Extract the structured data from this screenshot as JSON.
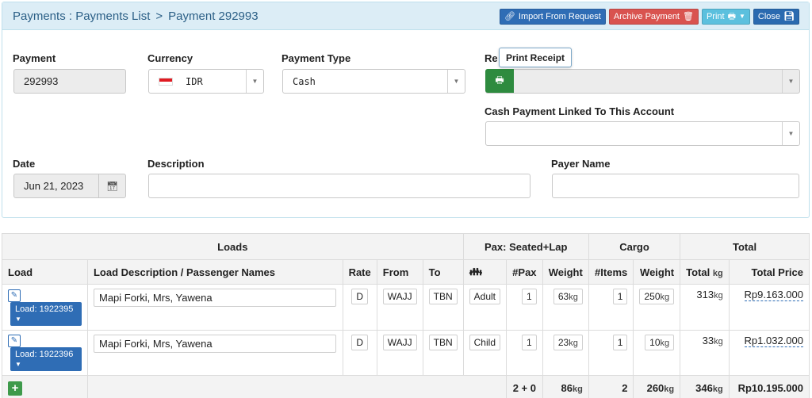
{
  "breadcrumb": {
    "section": "Payments : Payments List",
    "separator": ">",
    "current": "Payment 292993"
  },
  "header_buttons": {
    "import": "Import From Request",
    "archive": "Archive Payment",
    "print": "Print",
    "close": "Close"
  },
  "form": {
    "payment": {
      "label": "Payment",
      "value": "292993"
    },
    "currency": {
      "label": "Currency",
      "value": "IDR"
    },
    "payment_type": {
      "label": "Payment Type",
      "value": "Cash"
    },
    "receipt": {
      "label_visible": "Re",
      "tooltip": "Print Receipt"
    },
    "cash_account": {
      "label": "Cash Payment Linked To This Account",
      "value": ""
    },
    "date": {
      "label": "Date",
      "value": "Jun 21, 2023"
    },
    "description": {
      "label": "Description",
      "value": ""
    },
    "payer_name": {
      "label": "Payer Name",
      "value": ""
    }
  },
  "table": {
    "groups": {
      "loads": "Loads",
      "pax": "Pax: Seated+Lap",
      "cargo": "Cargo",
      "total": "Total"
    },
    "columns": {
      "load": "Load",
      "description": "Load Description / Passenger Names",
      "rate": "Rate",
      "from": "From",
      "to": "To",
      "pax_type_icon": "people-icon",
      "pax": "#Pax",
      "pax_weight": "Weight",
      "items": "#Items",
      "cargo_weight": "Weight",
      "total_kg": "Total",
      "total_kg_unit": "kg",
      "total_price": "Total Price"
    },
    "rows": [
      {
        "load": "Load: 1922395",
        "description": "Mapi Forki, Mrs, Yawena",
        "rate": "D",
        "from": "WAJJ",
        "to": "TBN",
        "pax_type": "Adult",
        "pax": "1",
        "pax_weight": "63",
        "items": "1",
        "cargo_weight": "250",
        "total_kg": "313",
        "total_price": "Rp9.163.000"
      },
      {
        "load": "Load: 1922396",
        "description": "Mapi Forki, Mrs, Yawena",
        "rate": "D",
        "from": "WAJJ",
        "to": "TBN",
        "pax_type": "Child",
        "pax": "1",
        "pax_weight": "23",
        "items": "1",
        "cargo_weight": "10",
        "total_kg": "33",
        "total_price": "Rp1.032.000"
      }
    ],
    "unit": "kg",
    "totals": {
      "pax": "2 + 0",
      "pax_weight": "86",
      "items": "2",
      "cargo_weight": "260",
      "total_kg": "346",
      "total_price": "Rp10.195.000"
    }
  },
  "colors": {
    "header_bg": "#dcedf6",
    "primary": "#2f6db5",
    "danger": "#d9534f",
    "info": "#5bc0de",
    "success": "#2e8b3f"
  }
}
